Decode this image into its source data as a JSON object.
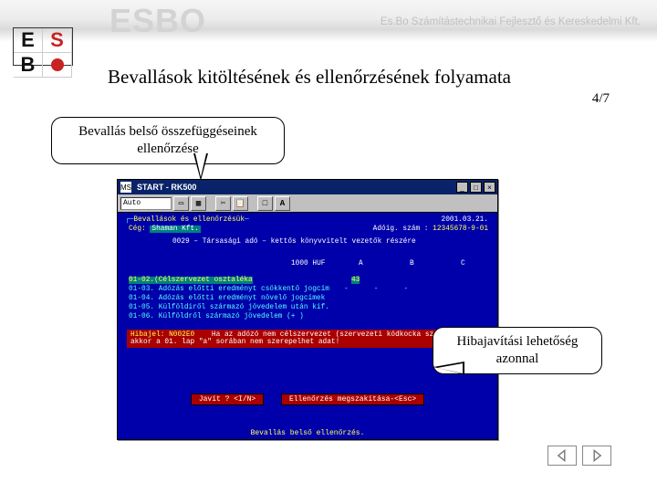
{
  "watermark": {
    "big": "ESBO",
    "sub": "Es.Bo Számítástechnikai Fejlesztő és Kereskedelmi Kft."
  },
  "logo": {
    "a": "E",
    "b": "S",
    "c": "B",
    "d": ""
  },
  "slide": {
    "title": "Bevallások kitöltésének és ellenőrzésének folyamata",
    "page": "4/7"
  },
  "callouts": {
    "c1": "Bevallás belső összefüggéseinek ellenőrzése",
    "c2": "Hibajavítási lehetőség azonnal"
  },
  "dos": {
    "title": "START - RK500",
    "auto_label": "Auto",
    "header_box": "Bevallások és ellenőrzésük",
    "right_date": "2001.03.21.",
    "ceg_label": "Cég:",
    "ceg_value": "Shaman Kft.",
    "adoig_label": "Adóig. szám :",
    "adoig_value": "12345678-9-01",
    "table_title": "0029 – Társasági adó – kettős könyvvitelt vezetők részére",
    "units": "1000 HUF",
    "cols": {
      "a": "A",
      "b": "B",
      "c": "C"
    },
    "rows": [
      {
        "code": "01-02.",
        "label": "(Célszervezet osztaléka",
        "a": "43"
      },
      {
        "code": "01-03.",
        "label": "Adózás előtti eredményt csökkentő jogcím"
      },
      {
        "code": "01-04.",
        "label": "Adózás előtti eredményt növelő jogcímek"
      },
      {
        "code": "01-05.",
        "label": "Külföldiről származó jövedelem után kif."
      },
      {
        "code": "01-06.",
        "label": "Külföldről származó jövedelem (+ )"
      }
    ],
    "error_title": "Hibajel: N002E0",
    "error_text": "Ha az adózó nem célszervezet (szervezeti kódkocka szerint), akkor a 01. lap \"a\" sorában nem szerepelhet adat!",
    "btn_fix": "Javít ? <I/N>",
    "btn_cancel": "Ellenőrzés megszakítása-<Esc>",
    "status": "Bevallás belső ellenőrzés."
  }
}
